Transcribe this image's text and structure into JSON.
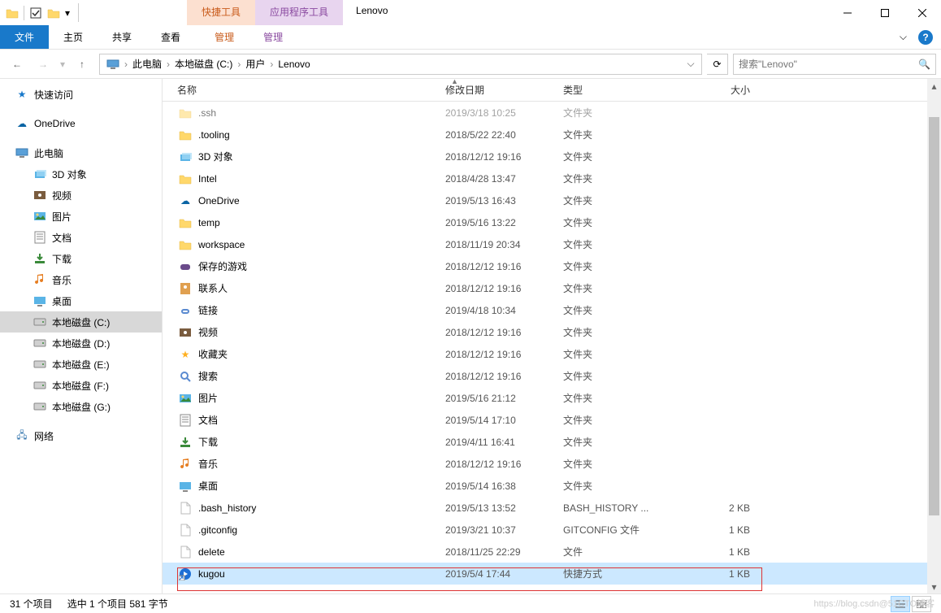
{
  "title": "Lenovo",
  "qat": {
    "checkbox_checked": true
  },
  "ctx_tabs": {
    "pic": "快捷工具",
    "app": "应用程序工具"
  },
  "ribbon": {
    "file": "文件",
    "tabs": [
      "主页",
      "共享",
      "查看"
    ],
    "ctx1": "管理",
    "ctx2": "管理",
    "help": "?"
  },
  "nav": {
    "back": "←",
    "forward": "→",
    "up": "↑"
  },
  "breadcrumbs": [
    "此电脑",
    "本地磁盘 (C:)",
    "用户",
    "Lenovo"
  ],
  "search": {
    "placeholder": "搜索\"Lenovo\""
  },
  "tree": {
    "quick_access": "快速访问",
    "onedrive": "OneDrive",
    "this_pc": "此电脑",
    "items": [
      {
        "label": "3D 对象",
        "icon": "3d"
      },
      {
        "label": "视频",
        "icon": "video"
      },
      {
        "label": "图片",
        "icon": "pic"
      },
      {
        "label": "文档",
        "icon": "doc"
      },
      {
        "label": "下载",
        "icon": "dl"
      },
      {
        "label": "音乐",
        "icon": "music"
      },
      {
        "label": "桌面",
        "icon": "desk"
      },
      {
        "label": "本地磁盘 (C:)",
        "icon": "disk",
        "selected": true
      },
      {
        "label": "本地磁盘 (D:)",
        "icon": "disk"
      },
      {
        "label": "本地磁盘 (E:)",
        "icon": "disk"
      },
      {
        "label": "本地磁盘 (F:)",
        "icon": "disk"
      },
      {
        "label": "本地磁盘 (G:)",
        "icon": "disk"
      }
    ],
    "network": "网络"
  },
  "columns": {
    "name": "名称",
    "date": "修改日期",
    "type": "类型",
    "size": "大小"
  },
  "files": [
    {
      "name": ".ssh",
      "date": "2019/3/18 10:25",
      "type": "文件夹",
      "size": "",
      "icon": "folder",
      "dim": true
    },
    {
      "name": ".tooling",
      "date": "2018/5/22 22:40",
      "type": "文件夹",
      "size": "",
      "icon": "folder"
    },
    {
      "name": "3D 对象",
      "date": "2018/12/12 19:16",
      "type": "文件夹",
      "size": "",
      "icon": "3d"
    },
    {
      "name": "Intel",
      "date": "2018/4/28 13:47",
      "type": "文件夹",
      "size": "",
      "icon": "folder"
    },
    {
      "name": "OneDrive",
      "date": "2019/5/13 16:43",
      "type": "文件夹",
      "size": "",
      "icon": "onedrive"
    },
    {
      "name": "temp",
      "date": "2019/5/16 13:22",
      "type": "文件夹",
      "size": "",
      "icon": "folder"
    },
    {
      "name": "workspace",
      "date": "2018/11/19 20:34",
      "type": "文件夹",
      "size": "",
      "icon": "folder"
    },
    {
      "name": "保存的游戏",
      "date": "2018/12/12 19:16",
      "type": "文件夹",
      "size": "",
      "icon": "games"
    },
    {
      "name": "联系人",
      "date": "2018/12/12 19:16",
      "type": "文件夹",
      "size": "",
      "icon": "contacts"
    },
    {
      "name": "链接",
      "date": "2019/4/18 10:34",
      "type": "文件夹",
      "size": "",
      "icon": "links"
    },
    {
      "name": "视频",
      "date": "2018/12/12 19:16",
      "type": "文件夹",
      "size": "",
      "icon": "video"
    },
    {
      "name": "收藏夹",
      "date": "2018/12/12 19:16",
      "type": "文件夹",
      "size": "",
      "icon": "fav"
    },
    {
      "name": "搜索",
      "date": "2018/12/12 19:16",
      "type": "文件夹",
      "size": "",
      "icon": "search"
    },
    {
      "name": "图片",
      "date": "2019/5/16 21:12",
      "type": "文件夹",
      "size": "",
      "icon": "pic"
    },
    {
      "name": "文档",
      "date": "2019/5/14 17:10",
      "type": "文件夹",
      "size": "",
      "icon": "doc"
    },
    {
      "name": "下载",
      "date": "2019/4/11 16:41",
      "type": "文件夹",
      "size": "",
      "icon": "dl"
    },
    {
      "name": "音乐",
      "date": "2018/12/12 19:16",
      "type": "文件夹",
      "size": "",
      "icon": "music"
    },
    {
      "name": "桌面",
      "date": "2019/5/14 16:38",
      "type": "文件夹",
      "size": "",
      "icon": "desk"
    },
    {
      "name": ".bash_history",
      "date": "2019/5/13 13:52",
      "type": "BASH_HISTORY ...",
      "size": "2 KB",
      "icon": "file"
    },
    {
      "name": ".gitconfig",
      "date": "2019/3/21 10:37",
      "type": "GITCONFIG 文件",
      "size": "1 KB",
      "icon": "file"
    },
    {
      "name": "delete",
      "date": "2018/11/25 22:29",
      "type": "文件",
      "size": "1 KB",
      "icon": "file"
    },
    {
      "name": "kugou",
      "date": "2019/5/4 17:44",
      "type": "快捷方式",
      "size": "1 KB",
      "icon": "shortcut",
      "selected": true
    }
  ],
  "status": {
    "count": "31 个项目",
    "selection": "选中 1 个项目 581 字节"
  },
  "watermark": "https://blog.csdn@51CTO博客"
}
